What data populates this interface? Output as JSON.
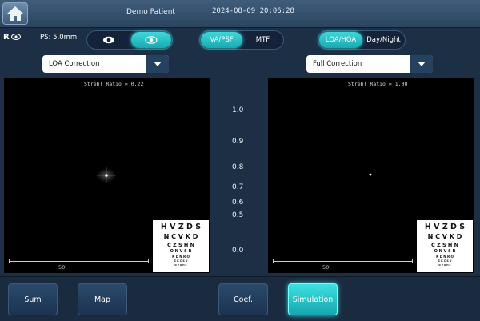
{
  "header": {
    "patient": "Demo Patient",
    "datetime": "2024-08-09 20:06:28"
  },
  "eye": {
    "label": "R"
  },
  "pupil": {
    "label": "PS: 5.0mm"
  },
  "mode_toggle": {
    "left": "VA/PSF",
    "right": "MTF",
    "active": "left"
  },
  "aberration_toggle": {
    "left": "LOA/HOA",
    "right": "Day/Night",
    "active": "left"
  },
  "left_panel": {
    "dropdown": "LOA Correction",
    "strehl": "Strehl Ratio = 0.22",
    "scale": "50'"
  },
  "right_panel": {
    "dropdown": "Full Correction",
    "strehl": "Strehl Ratio = 1.00",
    "scale": "50'"
  },
  "eye_chart": {
    "rows": [
      "H V Z D S",
      "N C V K D",
      "C Z S H N",
      "O N V S R",
      "K D N R O",
      "Z K C S V",
      "D V O H C"
    ]
  },
  "va_scale": [
    "1.0",
    "0.9",
    "0.8",
    "0.7",
    "0.6",
    "0.5",
    "0.0"
  ],
  "tabs": [
    {
      "label": "Sum",
      "active": false
    },
    {
      "label": "Map",
      "active": false
    },
    {
      "label": "Coef.",
      "active": false
    },
    {
      "label": "Simulation",
      "active": true
    }
  ],
  "colors": {
    "accent": "#2fd0d6",
    "panel": "#000000",
    "background": "#1c2f44"
  }
}
